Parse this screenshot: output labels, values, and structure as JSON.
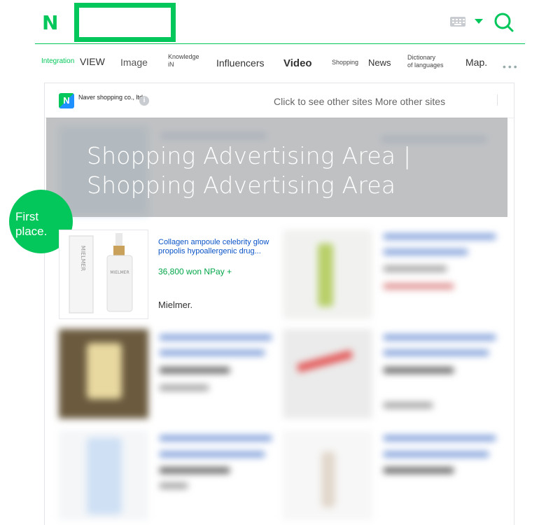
{
  "header": {
    "logo": "N",
    "search_value": "",
    "colors": {
      "brand": "#03c75a",
      "link": "#0a53c7"
    }
  },
  "tabs": [
    {
      "label": "Integration"
    },
    {
      "label": "VIEW"
    },
    {
      "label": "Image"
    },
    {
      "label": "Knowledge\niN"
    },
    {
      "label": "Influencers"
    },
    {
      "label": "Video"
    },
    {
      "label": "Shopping"
    },
    {
      "label": "News"
    },
    {
      "label": "Dictionary\nof languages"
    },
    {
      "label": "Map."
    }
  ],
  "card": {
    "brand_logo": "N",
    "brand_name": "Naver shopping co., ltd",
    "info_icon": "i",
    "other_sites": "Click to see other sites More other sites"
  },
  "ad_overlay": {
    "line1": "Shopping Advertising Area |",
    "line2": "Shopping Advertising Area"
  },
  "badge": "First place.",
  "product": {
    "title": "Collagen ampoule celebrity glow propolis hypoallergenic drug...",
    "price": "36,800 won NPay +",
    "seller": "Mielmer.",
    "image_brand": "MIELMER"
  }
}
